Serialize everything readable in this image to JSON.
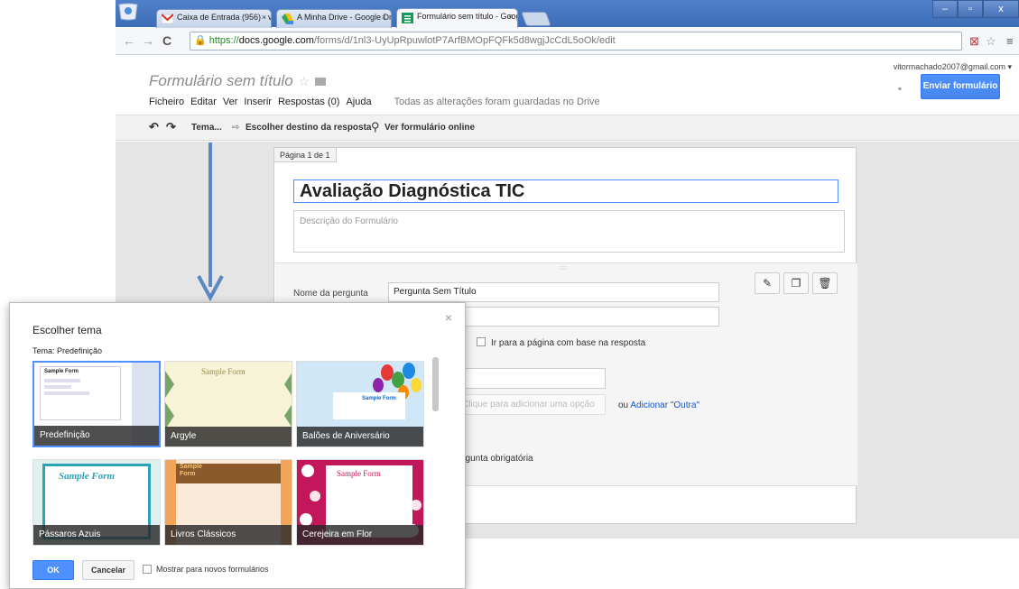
{
  "browser": {
    "tabs": [
      {
        "label": "Caixa de Entrada (956) - vit",
        "favicon": "gmail-icon"
      },
      {
        "label": "A Minha Drive - Google Drive",
        "favicon": "drive-icon"
      },
      {
        "label": "Formulário sem título - Googl",
        "favicon": "forms-icon"
      }
    ],
    "tab_close": "×",
    "url_https": "https://",
    "url_host": "docs.google.com",
    "url_rest": "/forms/d/1nl3-UyUpRpuwlotP7ArfBMOpFQFk5d8wgjJcCdL5oOk/edit",
    "window_controls": [
      "–",
      "▫",
      "x"
    ]
  },
  "header": {
    "title": "Formulário sem título",
    "star": "☆",
    "menu": [
      "Ficheiro",
      "Editar",
      "Ver",
      "Inserir",
      "Respostas (0)",
      "Ajuda"
    ],
    "save_status": "Todas as alterações foram guardadas no Drive",
    "account": "vitormachado2007@gmail.com",
    "account_caret": "▾",
    "send_button": "Enviar formulário"
  },
  "toolbar": {
    "undo": "↶",
    "redo": "↷",
    "theme": "Tema...",
    "response_dest": "Escolher destino da resposta",
    "view_online": "Ver formulário online"
  },
  "form": {
    "page_label": "Página 1 de 1",
    "title": "Avaliação Diagnóstica TIC",
    "description_placeholder": "Descrição do Formulário",
    "drag_handle": "::::::",
    "question_label": "Nome da pergunta",
    "question_value": "Pergunta Sem Título",
    "go_to_page": "Ir para a página com base na resposta",
    "add_option_placeholder": "Clique para adicionar uma opção",
    "outra_prefix": "ou ",
    "outra_link": "Adicionar \"Outra\"",
    "required_tail": "Pergunta obrigatória"
  },
  "dialog": {
    "title": "Escolher tema",
    "close": "×",
    "current_theme": "Tema: Predefinição",
    "themes": [
      "Predefinição",
      "Argyle",
      "Balões de Aniversário",
      "Pássaros Azuis",
      "Livros Clássicos",
      "Cerejeira em Flor"
    ],
    "sample": "Sample Form",
    "ok": "OK",
    "cancel": "Cancelar",
    "checkbox_label": "Mostrar para novos formulários"
  },
  "colors": {
    "accent_blue": "#4d90fe",
    "chrome_frame": "#3d6db8",
    "arrow": "#5b87c5"
  }
}
